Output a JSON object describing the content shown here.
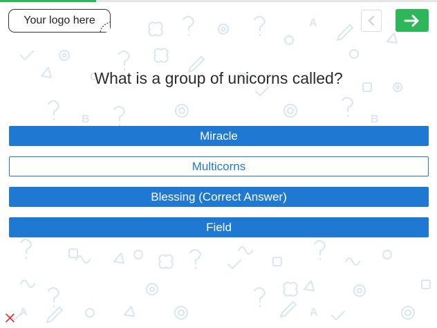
{
  "progress": {
    "fraction": 0.22,
    "color": "#2eb65a"
  },
  "logo": {
    "text": "Your logo here"
  },
  "navigation": {
    "back_icon": "chevron-left-icon",
    "next_icon": "arrow-right-icon",
    "next_color": "#2eb65a"
  },
  "question": {
    "text": "What is a group of unicorns called?"
  },
  "answers": [
    {
      "label": "Miracle",
      "style": "filled"
    },
    {
      "label": "Multicorns",
      "style": "outline"
    },
    {
      "label": "Blessing (Correct Answer)",
      "style": "filled"
    },
    {
      "label": "Field",
      "style": "filled"
    }
  ],
  "colors": {
    "accent": "#1f78d1",
    "pattern": "#dbe7f3",
    "close": "#e03030"
  },
  "close": {
    "icon": "close-icon"
  }
}
